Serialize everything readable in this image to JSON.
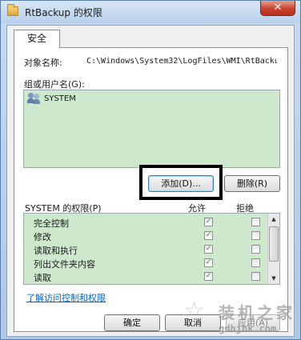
{
  "window": {
    "title": "RtBackup 的权限",
    "close_glyph": "✕"
  },
  "tabs": [
    {
      "label": "安全"
    }
  ],
  "object": {
    "label": "对象名称:",
    "value": "C:\\Windows\\System32\\LogFiles\\WMI\\RtBacku"
  },
  "users": {
    "label": "组或用户名(G):",
    "items": [
      {
        "name": "SYSTEM",
        "icon": "users-icon"
      }
    ]
  },
  "buttons": {
    "add": "添加(D)...",
    "remove": "删除(R)",
    "ok": "确定",
    "cancel": "取消",
    "apply": "应用(A)"
  },
  "permissions": {
    "label": "SYSTEM 的权限(P)",
    "allow_header": "允许",
    "deny_header": "拒绝",
    "rows": [
      {
        "name": "完全控制",
        "allow": true,
        "deny": false
      },
      {
        "name": "修改",
        "allow": true,
        "deny": false
      },
      {
        "name": "读取和执行",
        "allow": true,
        "deny": false
      },
      {
        "name": "列出文件夹内容",
        "allow": true,
        "deny": false
      },
      {
        "name": "读取",
        "allow": true,
        "deny": false
      }
    ]
  },
  "link": "了解访问控制和权限",
  "watermark": {
    "logo": "装机之家",
    "url": "gdhjbk.com"
  },
  "colors": {
    "list_bg": "#cde8cc",
    "accent": "#0066cc",
    "close": "#c9432f"
  }
}
